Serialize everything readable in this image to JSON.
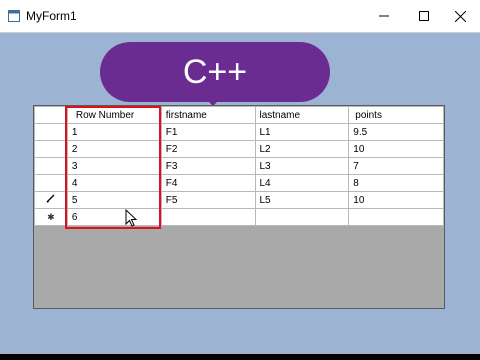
{
  "window": {
    "title": "MyForm1",
    "controls": {
      "minimize_icon": "minimize-icon",
      "maximize_icon": "maximize-icon",
      "close_icon": "close-icon"
    }
  },
  "badge": {
    "text": "C++",
    "color": "#6a2c91"
  },
  "grid": {
    "columns": [
      "Row Number",
      "firstname",
      "lastname",
      "points"
    ],
    "rows": [
      {
        "marker": "",
        "cells": [
          "1",
          "F1",
          "L1",
          "9.5"
        ]
      },
      {
        "marker": "",
        "cells": [
          "2",
          "F2",
          "L2",
          "10"
        ]
      },
      {
        "marker": "",
        "cells": [
          "3",
          "F3",
          "L3",
          "7"
        ]
      },
      {
        "marker": "",
        "cells": [
          "4",
          "F4",
          "L4",
          "8"
        ]
      },
      {
        "marker": "pencil-icon",
        "cells": [
          "5",
          "F5",
          "L5",
          "10"
        ]
      },
      {
        "marker": "new-row-icon",
        "cells": [
          "6",
          "",
          "",
          ""
        ]
      }
    ],
    "highlight_color": "#e0101a"
  }
}
